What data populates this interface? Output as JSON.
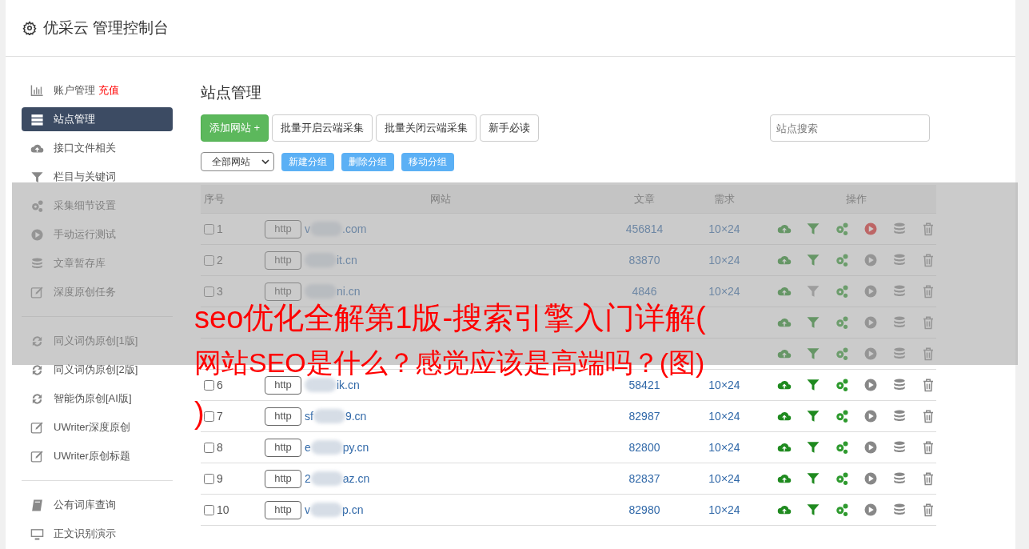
{
  "header": {
    "title": "优采云 管理控制台"
  },
  "sidebar": {
    "groups": [
      [
        {
          "label": "账户管理",
          "badge": "充值",
          "kind": "chart",
          "selected": false
        },
        {
          "label": "站点管理",
          "kind": "list",
          "selected": true
        },
        {
          "label": "接口文件相关",
          "kind": "cloud",
          "selected": false
        },
        {
          "label": "栏目与关键词",
          "kind": "filter",
          "selected": false
        },
        {
          "label": "采集细节设置",
          "kind": "gears",
          "selected": false
        },
        {
          "label": "手动运行测试",
          "kind": "play",
          "selected": false
        },
        {
          "label": "文章暂存库",
          "kind": "database",
          "selected": false
        },
        {
          "label": "深度原创任务",
          "kind": "edit",
          "selected": false
        }
      ],
      [
        {
          "label": "同义词伪原创[1版]",
          "kind": "refresh",
          "selected": false
        },
        {
          "label": "同义词伪原创[2版]",
          "kind": "refresh",
          "selected": false
        },
        {
          "label": "智能伪原创[AI版]",
          "kind": "refresh",
          "selected": false
        },
        {
          "label": "UWriter深度原创",
          "kind": "edit",
          "selected": false
        },
        {
          "label": "UWriter原创标题",
          "kind": "edit",
          "selected": false
        }
      ],
      [
        {
          "label": "公有词库查询",
          "kind": "book",
          "selected": false
        },
        {
          "label": "正文识别演示",
          "kind": "monitor",
          "selected": false
        }
      ]
    ]
  },
  "main": {
    "title": "站点管理",
    "buttons": [
      {
        "label": "添加网站 +",
        "kind": "primary"
      },
      {
        "label": "批量开启云端采集",
        "kind": "default"
      },
      {
        "label": "批量关闭云端采集",
        "kind": "default"
      },
      {
        "label": "新手必读",
        "kind": "default"
      }
    ],
    "search": {
      "placeholder": "站点搜索"
    },
    "group_select": {
      "value": "全部网站"
    },
    "group_buttons": [
      "新建分组",
      "删除分组",
      "移动分组"
    ],
    "table": {
      "columns": [
        "序号",
        "网站",
        "文章",
        "需求",
        "操作"
      ],
      "rows": [
        {
          "no": "1",
          "checked": false,
          "protocol": "http",
          "site_head": "v",
          "site_tail": ".com",
          "articles": "456814",
          "demand": "10×24",
          "filter_on": true,
          "running": true
        },
        {
          "no": "2",
          "checked": false,
          "protocol": "http",
          "site_tail": "it.cn",
          "articles": "83870",
          "demand": "10×24",
          "filter_on": true,
          "running": false
        },
        {
          "no": "3",
          "checked": false,
          "protocol": "http",
          "site_tail": "ni.cn",
          "articles": "4846",
          "demand": "10×24",
          "filter_on": false,
          "running": false
        },
        {
          "filter_on": true,
          "running": false
        },
        {
          "filter_on": true,
          "running": false
        },
        {
          "no": "6",
          "checked": false,
          "protocol": "http",
          "site_tail": "ik.cn",
          "articles": "58421",
          "demand": "10×24",
          "filter_on": true,
          "running": false
        },
        {
          "no": "7",
          "checked": false,
          "protocol": "http",
          "site_head": "sf",
          "site_tail": "9.cn",
          "articles": "82987",
          "demand": "10×24",
          "filter_on": true,
          "running": false
        },
        {
          "no": "8",
          "checked": false,
          "protocol": "http",
          "site_head": "e",
          "site_tail": "py.cn",
          "articles": "82800",
          "demand": "10×24",
          "filter_on": true,
          "running": false
        },
        {
          "no": "9",
          "checked": false,
          "protocol": "http",
          "site_head": "2",
          "site_tail": "az.cn",
          "articles": "82837",
          "demand": "10×24",
          "filter_on": true,
          "running": false
        },
        {
          "no": "10",
          "checked": false,
          "protocol": "http",
          "site_head": "v",
          "site_tail": "p.cn",
          "articles": "82980",
          "demand": "10×24",
          "filter_on": true,
          "running": false
        }
      ]
    }
  },
  "caption_overlay": {
    "lines": [
      "seo优化全解第1版-搜索引擎入门详解(",
      "网站SEO是什么？感觉应该是高端吗？(图)",
      ")"
    ]
  }
}
